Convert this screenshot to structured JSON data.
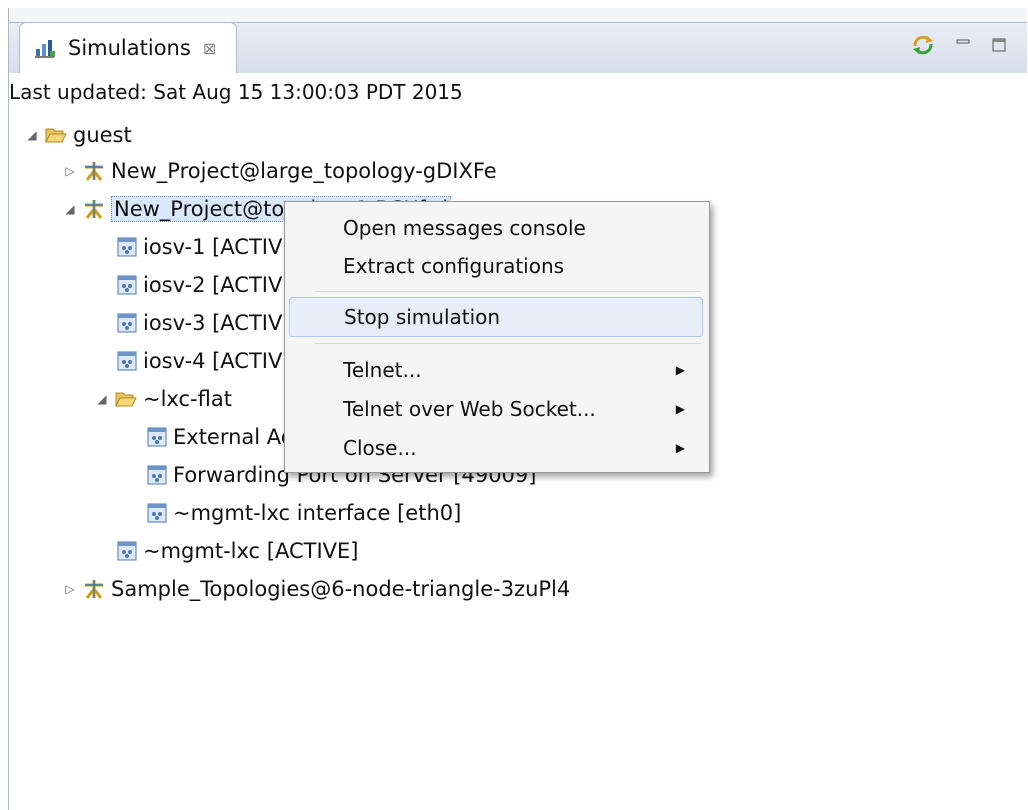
{
  "view": {
    "tab_title": "Simulations",
    "tab_close": "⊠",
    "tools": [
      "sync-icon",
      "minimize-icon",
      "maximize-icon"
    ]
  },
  "status": "Last updated: Sat Aug 15 13:00:03 PDT 2015",
  "tree": {
    "guest": "guest",
    "project_large": "New_Project@large_topology-gDIXFe",
    "project_topology1": "New_Project@topology1-BCXfwl",
    "iosv1": "iosv-1  [ACTIVE]",
    "iosv2": "iosv-2  [ACTIVE]",
    "iosv3": "iosv-3  [ACTIVE]",
    "iosv4": "iosv-4  [ACTIVE]",
    "lxc_flat": "~lxc-flat",
    "external": "External Address",
    "forwarding": "Forwarding Port on Server  [49009]",
    "mgmt_iface": "~mgmt-lxc interface  [eth0]",
    "mgmt_lxc": "~mgmt-lxc  [ACTIVE]",
    "sample": "Sample_Topologies@6-node-triangle-3zuPl4"
  },
  "context_menu": {
    "open_console": "Open messages console",
    "extract": "Extract configurations",
    "stop": "Stop simulation",
    "telnet": "Telnet...",
    "telnet_ws": "Telnet over Web Socket...",
    "close": "Close..."
  }
}
